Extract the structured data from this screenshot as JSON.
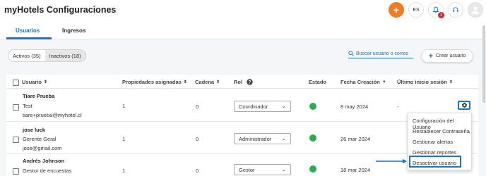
{
  "app": {
    "title": "myHotels Configuraciones"
  },
  "topbar": {
    "language": "ES",
    "notifications_count": "1"
  },
  "tabs": [
    {
      "label": "Usuarios",
      "active": true
    },
    {
      "label": "Ingresos",
      "active": false
    }
  ],
  "filters": {
    "active_label": "Activos (35)",
    "inactive_label": "Inactivos (18)"
  },
  "search": {
    "placeholder": "Buscar usuario o correo"
  },
  "create_button": {
    "label": "Crear usuario"
  },
  "table": {
    "headers": {
      "user": "Usuario",
      "properties": "Propiedades asignadas",
      "chain": "Cadena",
      "role": "Rol",
      "state": "Estado",
      "created": "Fecha Creación",
      "last_login": "Último inicio sesión"
    },
    "rows": [
      {
        "name": "Tiare Prueba",
        "position": "Test",
        "email": "tiare+prueba@myhotel.cl",
        "properties": "1",
        "chain": "0",
        "role": "Coordinador",
        "created": "8 may 2024",
        "last_login": "-"
      },
      {
        "name": "jose luck",
        "position": "Gerente Geral",
        "email": "jose@gmail.com",
        "properties": "1",
        "chain": "0",
        "role": "Administrador",
        "created": "26 mar 2024",
        "last_login": "-"
      },
      {
        "name": "Andrés Johnson",
        "position": "Gestor de encuestas",
        "email": "",
        "properties": "1",
        "chain": "0",
        "role": "Gestor",
        "created": "18 mar 2024",
        "last_login": "-"
      }
    ]
  },
  "context_menu": {
    "items": [
      "Configuración del Usuario",
      "Restablecer Contraseña",
      "Gestionar alertas",
      "Gestionar reportes",
      "Desactivar usuario"
    ]
  },
  "colors": {
    "accent": "#1a73c9",
    "orange": "#f47b20",
    "active_green": "#22b14c",
    "badge_red": "#d9232e"
  }
}
